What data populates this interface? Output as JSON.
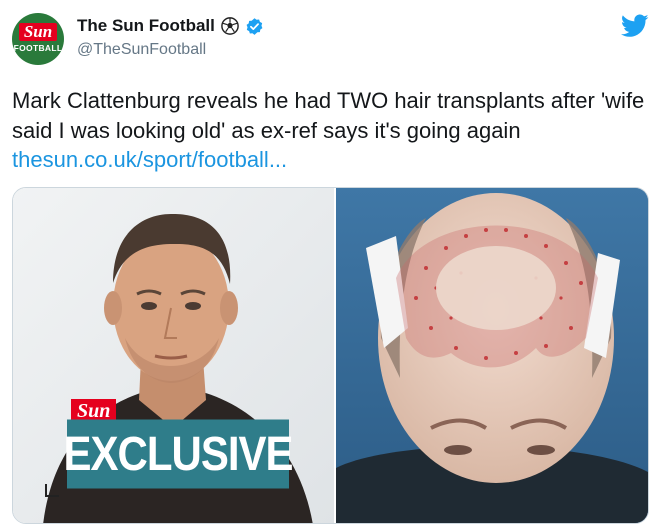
{
  "account": {
    "display_name": "The Sun Football",
    "handle": "@TheSunFootball",
    "avatar_brand": "Sun",
    "avatar_subtitle": "FOOTBALL",
    "verified": true
  },
  "tweet": {
    "text": "Mark Clattenburg reveals he had TWO hair transplants after 'wife said I was looking old' as ex-ref says it's going again",
    "link": "thesun.co.uk/sport/football..."
  },
  "media": {
    "left_badge_brand": "Sun",
    "left_badge_label": "EXCLUSIVE"
  },
  "colors": {
    "link": "#1b95e0",
    "twitter_blue": "#1da1f2",
    "verified_blue": "#1da1f2",
    "sun_red": "#e5001e",
    "avatar_green": "#2a7a3b",
    "exclusive_teal": "#2f7d8a"
  },
  "icons": [
    "soccer-ball-icon",
    "verified-badge-icon",
    "twitter-bird-icon"
  ]
}
